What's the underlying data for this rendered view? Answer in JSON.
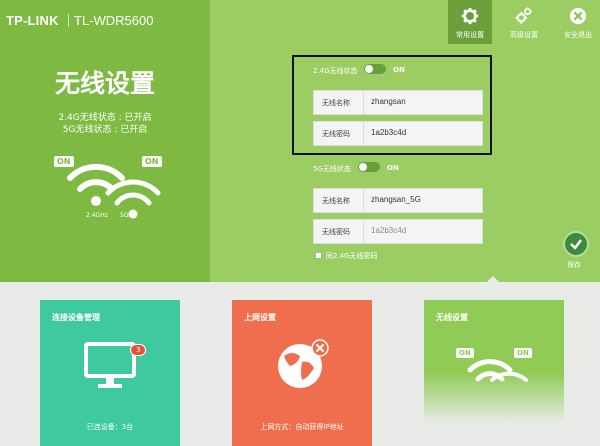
{
  "header": {
    "brand": "TP-LINK",
    "model": "TL-WDR5600"
  },
  "toolbar": [
    {
      "label": "常用设置",
      "icon": "gear-icon",
      "active": true
    },
    {
      "label": "高级设置",
      "icon": "gears-icon",
      "active": false
    },
    {
      "label": "安全退出",
      "icon": "close-icon",
      "active": false
    }
  ],
  "left": {
    "title": "无线设置",
    "status_24g": "2.4G无线状态 : 已开启",
    "status_5g": "5G无线状态 : 已开启",
    "badge_on_left": "ON",
    "badge_on_right": "ON",
    "band_24": "2.4GHz",
    "band_5": "5GHz"
  },
  "wifi24": {
    "state_label": "2.4G无线状态",
    "state_value": "ON",
    "name_label": "无线名称",
    "name_value": "zhangsan",
    "pwd_label": "无线密码",
    "pwd_value": "1a2b3c4d"
  },
  "wifi5": {
    "state_label": "5G无线状态",
    "state_value": "ON",
    "name_label": "无线名称",
    "name_value": "zhangsan_5G",
    "pwd_label": "无线密码",
    "pwd_value": "1a2b3c4d"
  },
  "same_pwd_label": "同2.4G无线密码",
  "save_label": "保存",
  "cards": [
    {
      "title": "连接设备管理",
      "footer": "已连设备：3台",
      "count": "3"
    },
    {
      "title": "上网设置",
      "footer": "上网方式：自动获得IP地址"
    },
    {
      "title": "无线设置",
      "badge_left": "ON",
      "badge_right": "ON"
    }
  ],
  "colors": {
    "left_panel": "#7eba42",
    "main_green": "#9bcd62",
    "card1": "#3ec9a1",
    "card2": "#ef6e4e",
    "card3": "#8fcb55"
  }
}
